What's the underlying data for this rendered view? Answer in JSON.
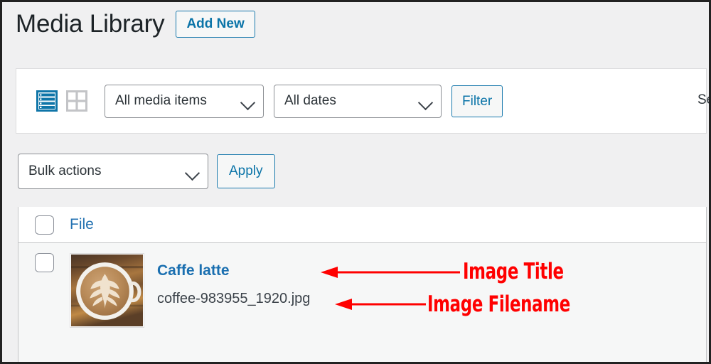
{
  "page": {
    "title": "Media Library",
    "add_new_label": "Add New"
  },
  "filter_bar": {
    "view_modes": [
      {
        "name": "list-view",
        "label": "List view",
        "active": true
      },
      {
        "name": "grid-view",
        "label": "Grid view",
        "active": false
      }
    ],
    "media_type_select": {
      "value": "All media items",
      "options": [
        "All media items"
      ]
    },
    "date_select": {
      "value": "All dates",
      "options": [
        "All dates"
      ]
    },
    "filter_button": "Filter",
    "search_label": "Se"
  },
  "bulk_bar": {
    "bulk_select": {
      "value": "Bulk actions",
      "options": [
        "Bulk actions"
      ]
    },
    "apply_button": "Apply"
  },
  "table": {
    "columns": [
      "File"
    ],
    "select_all_checked": false,
    "rows": [
      {
        "checked": false,
        "title": "Caffe latte",
        "filename": "coffee-983955_1920.jpg",
        "thumbnail_alt": "Cup of caffe latte with rosetta art on a wooden table"
      }
    ]
  },
  "annotations": [
    {
      "name": "image-title-annotation",
      "text": "Image Title",
      "color": "#ff0000"
    },
    {
      "name": "image-filename-annotation",
      "text": "Image Filename",
      "color": "#ff0000"
    }
  ],
  "colors": {
    "accent_blue": "#2271b1",
    "link_blue": "#1a6fb0",
    "annotation_red": "#ff0000",
    "page_background": "#f0f0f1",
    "panel_background": "#ffffff",
    "row_background": "#f6f7f7"
  }
}
